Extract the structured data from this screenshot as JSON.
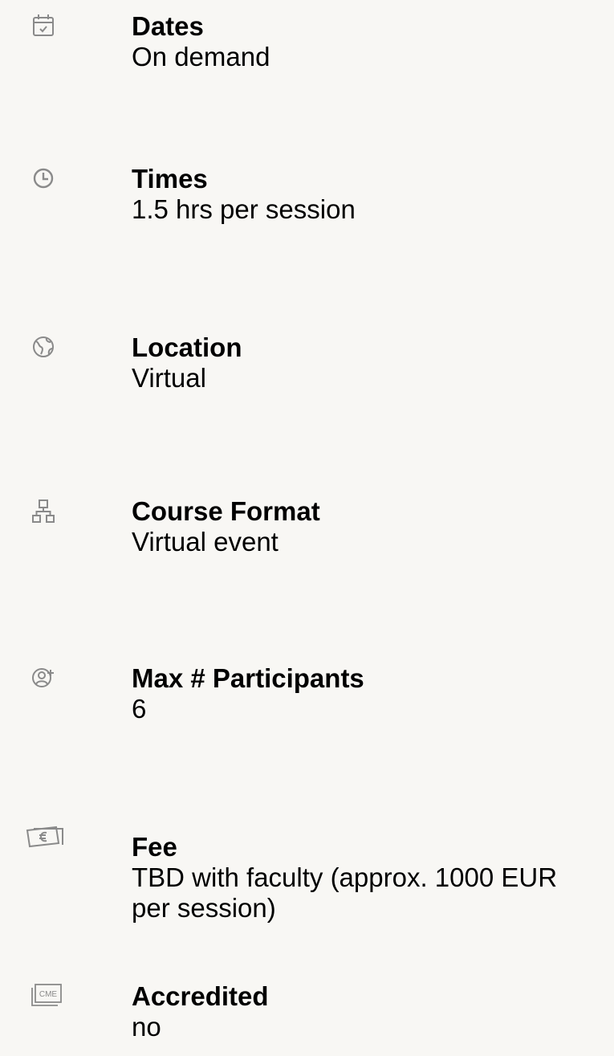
{
  "details": [
    {
      "icon": "calendar-icon",
      "label": "Dates",
      "value": "On demand"
    },
    {
      "icon": "clock-icon",
      "label": "Times",
      "value": "1.5 hrs per session"
    },
    {
      "icon": "globe-icon",
      "label": "Location",
      "value": "Virtual"
    },
    {
      "icon": "sitemap-icon",
      "label": "Course Format",
      "value": "Virtual event"
    },
    {
      "icon": "user-add-icon",
      "label": "Max # Participants",
      "value": "6"
    },
    {
      "icon": "money-icon",
      "label": "Fee",
      "value": "TBD with faculty (approx. 1000 EUR per session)"
    },
    {
      "icon": "cme-certificate-icon",
      "label": "Accredited",
      "value": "no"
    }
  ],
  "colors": {
    "background": "#f8f7f4",
    "icon": "#8a8a8a",
    "text": "#000000"
  }
}
